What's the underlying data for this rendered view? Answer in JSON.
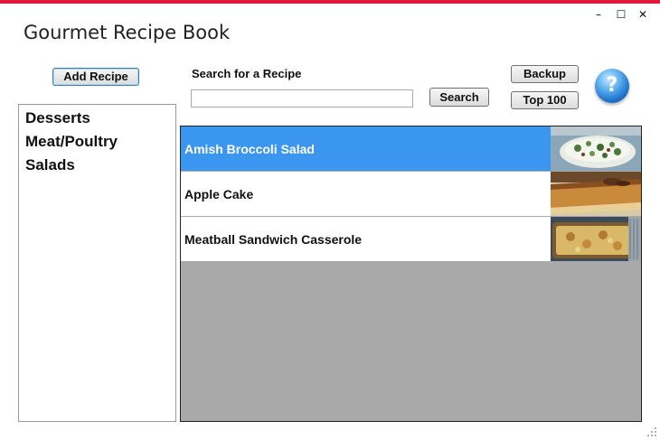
{
  "window": {
    "title": "Gourmet Recipe Book",
    "controls": {
      "minimize": "–",
      "maximize": "☐",
      "close": "✕"
    },
    "accent_color": "#e3173d"
  },
  "toolbar": {
    "add_recipe_label": "Add Recipe",
    "search_label": "Search for a Recipe",
    "search_value": "",
    "search_button_label": "Search",
    "backup_label": "Backup",
    "top100_label": "Top 100",
    "help_symbol": "?"
  },
  "categories": [
    "Desserts",
    "Meat/Poultry",
    "Salads"
  ],
  "recipes": [
    {
      "name": "Amish Broccoli Salad",
      "selected": true,
      "thumb_icon": "broccoli-salad-photo"
    },
    {
      "name": "Apple Cake",
      "selected": false,
      "thumb_icon": "apple-cake-photo"
    },
    {
      "name": "Meatball Sandwich Casserole",
      "selected": false,
      "thumb_icon": "casserole-photo"
    }
  ],
  "colors": {
    "selected_row": "#3b96f0",
    "list_background": "#a9a9a9"
  }
}
